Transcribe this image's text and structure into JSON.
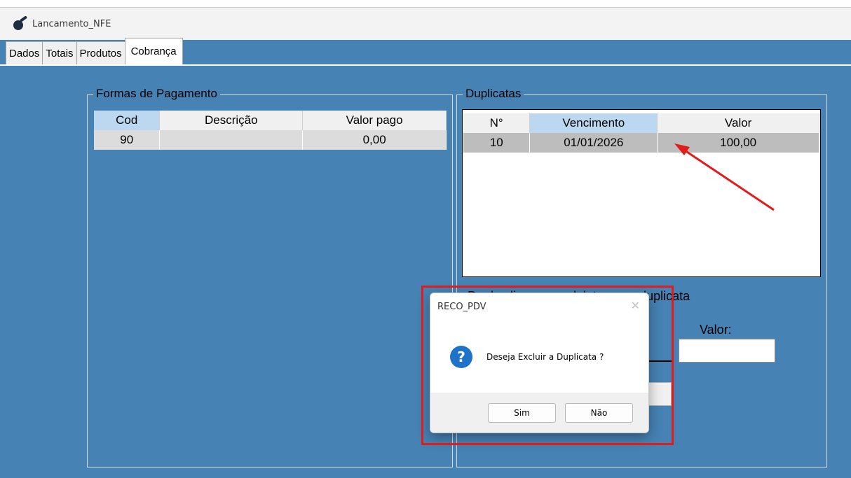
{
  "window": {
    "title": "Lancamento_NFE"
  },
  "tabs": [
    {
      "label": "Dados"
    },
    {
      "label": "Totais"
    },
    {
      "label": "Produtos"
    },
    {
      "label": "Cobrança"
    }
  ],
  "pagamento": {
    "title": "Formas de Pagamento",
    "columns": [
      "Cod",
      "Descrição",
      "Valor pago"
    ],
    "rows": [
      {
        "cod": "90",
        "descricao": "",
        "valor": "0,00"
      }
    ]
  },
  "duplicatas": {
    "title": "Duplicatas",
    "columns": [
      "N°",
      "Vencimento",
      "Valor"
    ],
    "rows": [
      {
        "n": "10",
        "vencimento": "01/01/2026",
        "valor": "100,00"
      }
    ],
    "hint": "Duplo clique para deletar uma duplicata",
    "valor_label": "Valor:"
  },
  "dialog": {
    "title": "RECO_PDV",
    "close": "✕",
    "icon": "?",
    "message": "Deseja Excluir a Duplicata ?",
    "yes": "Sim",
    "no": "Não"
  },
  "annotation_color": "#e21b1b"
}
